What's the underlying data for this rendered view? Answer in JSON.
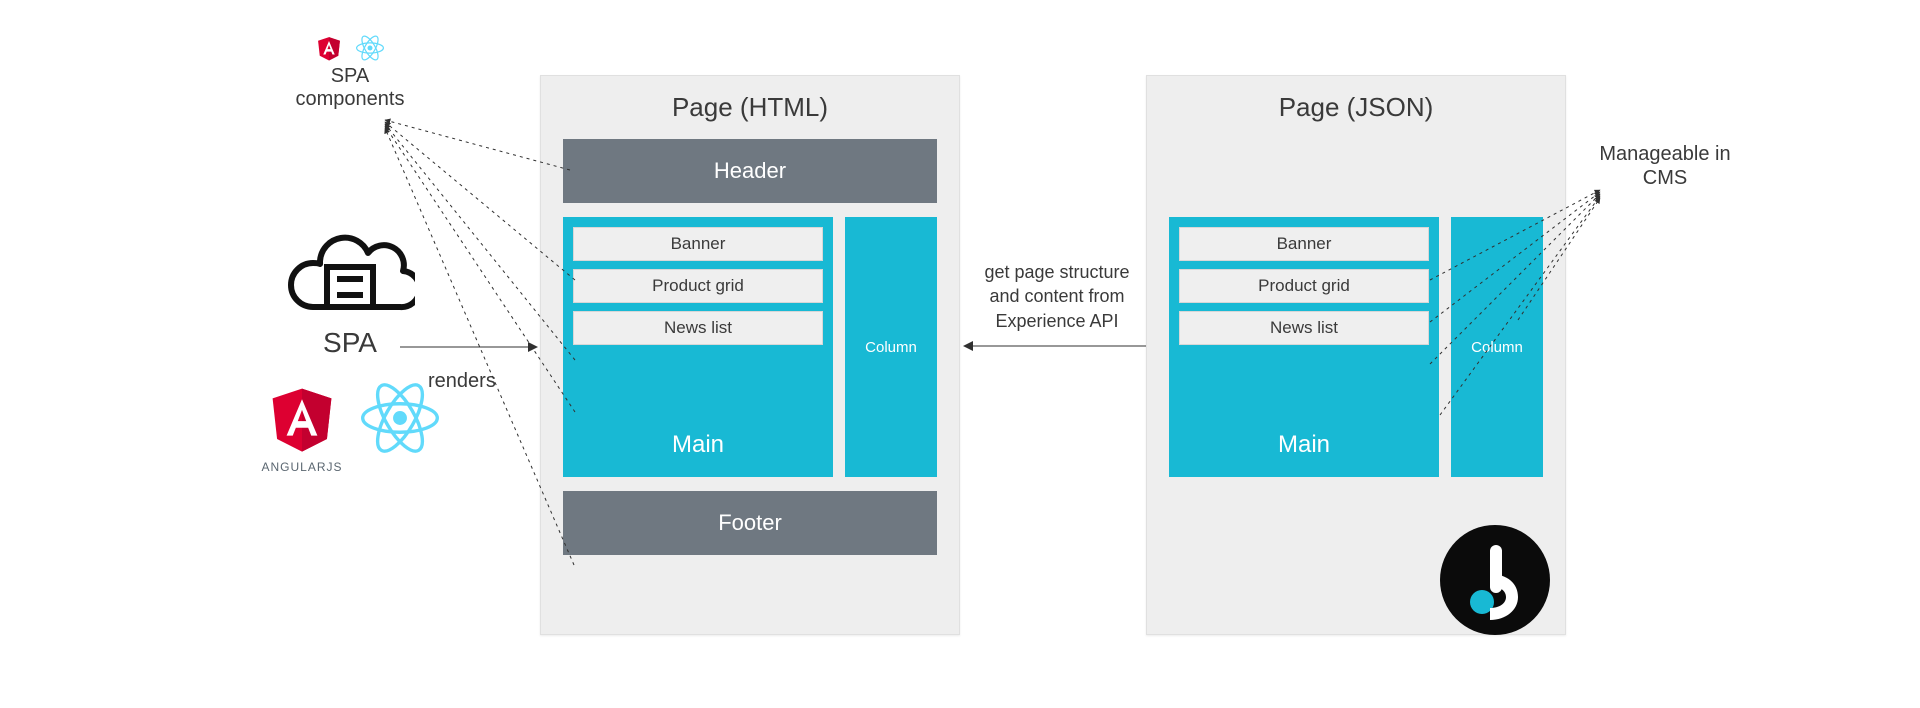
{
  "left": {
    "components_label_line1": "SPA",
    "components_label_line2": "components",
    "spa_label": "SPA",
    "renders_label": "renders",
    "angular_label": "ANGULARJS"
  },
  "middle": {
    "api_label": "get page structure and content from Experience API"
  },
  "right": {
    "cms_label": "Manageable in CMS"
  },
  "page_html": {
    "title": "Page (HTML)",
    "header_label": "Header",
    "footer_label": "Footer",
    "main_label": "Main",
    "column_label": "Column",
    "slots": [
      "Banner",
      "Product grid",
      "News list"
    ]
  },
  "page_json": {
    "title": "Page (JSON)",
    "main_label": "Main",
    "column_label": "Column",
    "slots": [
      "Banner",
      "Product grid",
      "News list"
    ]
  },
  "icons": {
    "mini_angular": "angular-icon",
    "mini_react": "react-icon",
    "big_angular": "angular-icon",
    "big_react": "react-icon",
    "cloud_server": "cloud-server-icon",
    "bloomreach": "bloomreach-logo-icon"
  },
  "colors": {
    "panel_bg": "#eeeeee",
    "bar_bg": "#6f7881",
    "cyan": "#18b9d4",
    "slot_bg": "#efefef"
  }
}
